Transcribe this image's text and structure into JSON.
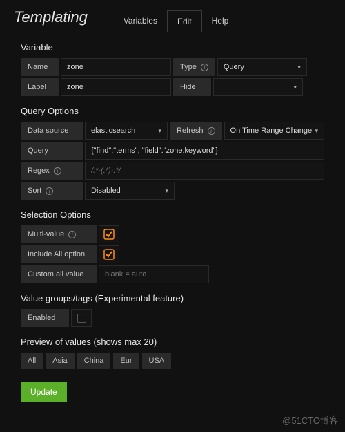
{
  "header": {
    "title": "Templating",
    "tabs": [
      "Variables",
      "Edit",
      "Help"
    ],
    "active_tab": "Edit"
  },
  "variable": {
    "section": "Variable",
    "name_label": "Name",
    "name_value": "zone",
    "type_label": "Type",
    "type_value": "Query",
    "label_label": "Label",
    "label_value": "zone",
    "hide_label": "Hide",
    "hide_value": ""
  },
  "query_options": {
    "section": "Query Options",
    "datasource_label": "Data source",
    "datasource_value": "elasticsearch",
    "refresh_label": "Refresh",
    "refresh_value": "On Time Range Change",
    "query_label": "Query",
    "query_value": "{\"find\":\"terms\", \"field\":\"zone.keyword\"}",
    "regex_label": "Regex",
    "regex_placeholder": "/.*-(.*)-.*/",
    "sort_label": "Sort",
    "sort_value": "Disabled"
  },
  "selection_options": {
    "section": "Selection Options",
    "multi_label": "Multi-value",
    "multi_checked": true,
    "include_all_label": "Include All option",
    "include_all_checked": true,
    "custom_all_label": "Custom all value",
    "custom_all_placeholder": "blank = auto"
  },
  "value_groups": {
    "section": "Value groups/tags (Experimental feature)",
    "enabled_label": "Enabled",
    "enabled_checked": false
  },
  "preview": {
    "section": "Preview of values (shows max 20)",
    "values": [
      "All",
      "Asia",
      "China",
      "Eur",
      "USA"
    ]
  },
  "buttons": {
    "update": "Update"
  },
  "watermark": "@51CTO博客"
}
